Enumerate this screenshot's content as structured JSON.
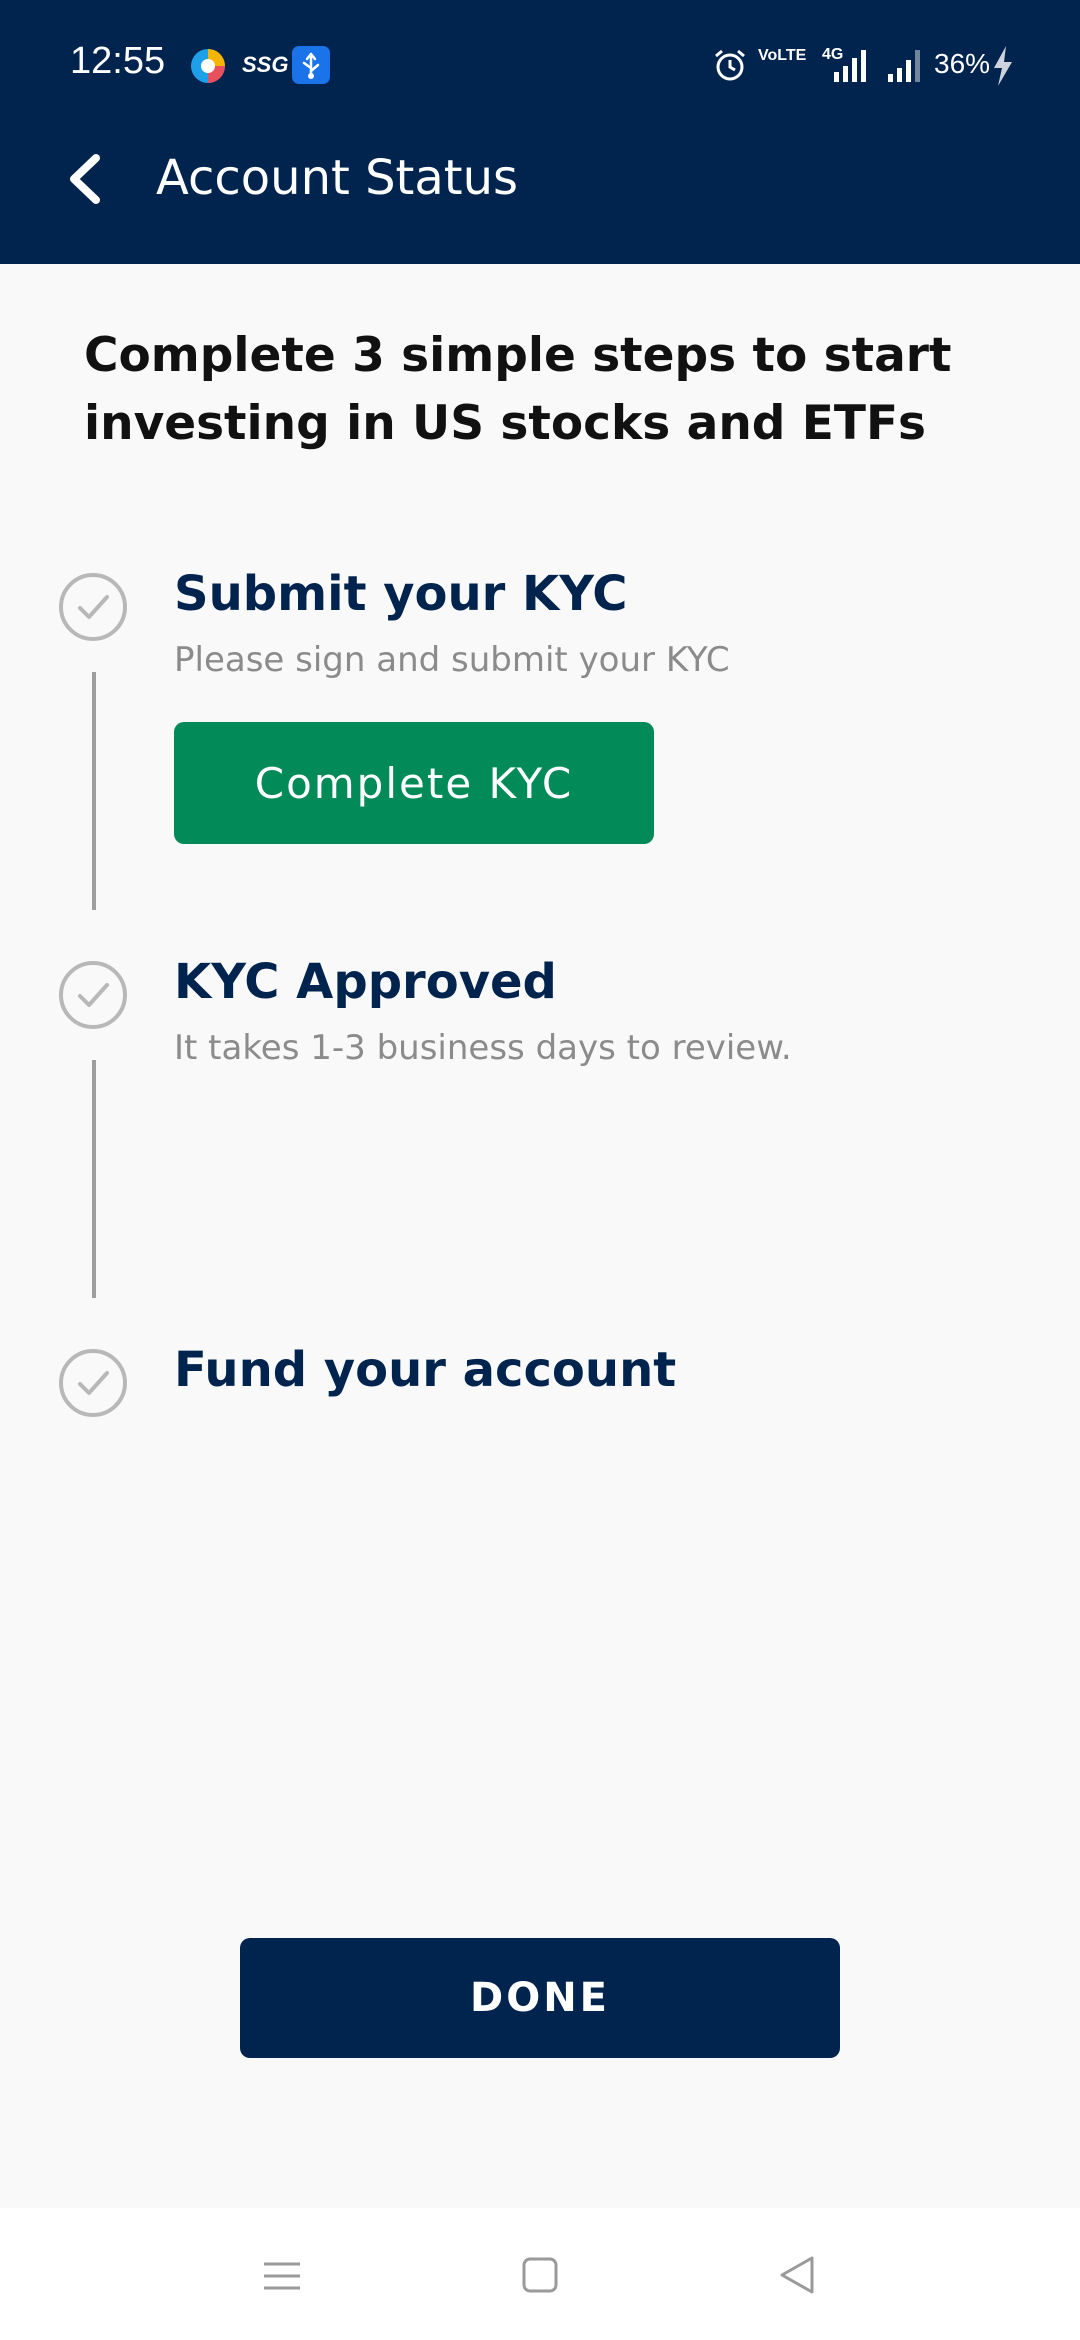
{
  "status_bar": {
    "time": "12:55",
    "battery": "36%",
    "icons": [
      "browser-icon",
      "ssg-icon",
      "usb-icon",
      "alarm-icon",
      "volte-icon",
      "signal-4g-icon",
      "signal-icon",
      "charging-icon"
    ],
    "ssg_label": "SSG",
    "network_label": "4G",
    "volte_label": "VoLTE"
  },
  "toolbar": {
    "title": "Account Status",
    "back_icon": "chevron-left-icon"
  },
  "intro": {
    "text": "Complete 3 simple steps to start investing in US stocks and ETFs"
  },
  "steps": [
    {
      "title": "Submit your KYC",
      "subtitle": "Please sign and submit your KYC",
      "button_label": "Complete KYC",
      "icon": "check-circle-icon"
    },
    {
      "title": "KYC Approved",
      "subtitle": "It takes 1-3 business days to review.",
      "icon": "check-circle-icon"
    },
    {
      "title": "Fund your account",
      "icon": "check-circle-icon"
    }
  ],
  "done_button": {
    "label": "DONE"
  },
  "nav": {
    "buttons": [
      "menu-icon",
      "home-square-icon",
      "back-triangle-icon"
    ]
  },
  "colors": {
    "header_bg": "#01244f",
    "accent_green": "#028a58",
    "step_title": "#01244f",
    "subtitle_gray": "#8b8b8b"
  }
}
